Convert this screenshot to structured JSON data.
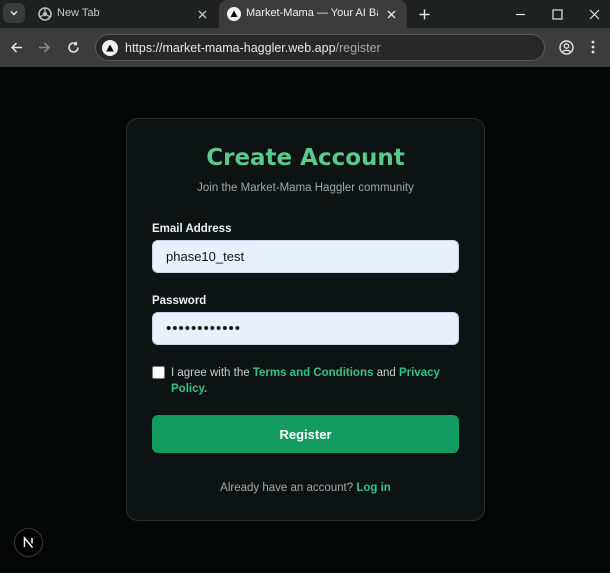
{
  "browser": {
    "tabs": [
      {
        "title": "New Tab",
        "icon": "chrome-icon",
        "active": false
      },
      {
        "title": "Market-Mama — Your AI Bargai",
        "icon": "site-triangle-icon",
        "active": true
      }
    ],
    "url_host": "https://market-mama-haggler.web.app",
    "url_path": "/register"
  },
  "register": {
    "title": "Create Account",
    "subtitle": "Join the Market-Mama Haggler community",
    "email_label": "Email Address",
    "email_value": "phase10_test",
    "password_label": "Password",
    "password_value": "phase10_test",
    "terms_prefix": "I agree with the ",
    "terms_link": "Terms and Conditions",
    "terms_and": " and ",
    "privacy_link": "Privacy Policy",
    "terms_suffix": ".",
    "submit_label": "Register",
    "login_prompt": "Already have an account? ",
    "login_link": "Log in"
  },
  "colors": {
    "accent": "#139c60",
    "title": "#5bc98a",
    "link": "#35c486"
  }
}
